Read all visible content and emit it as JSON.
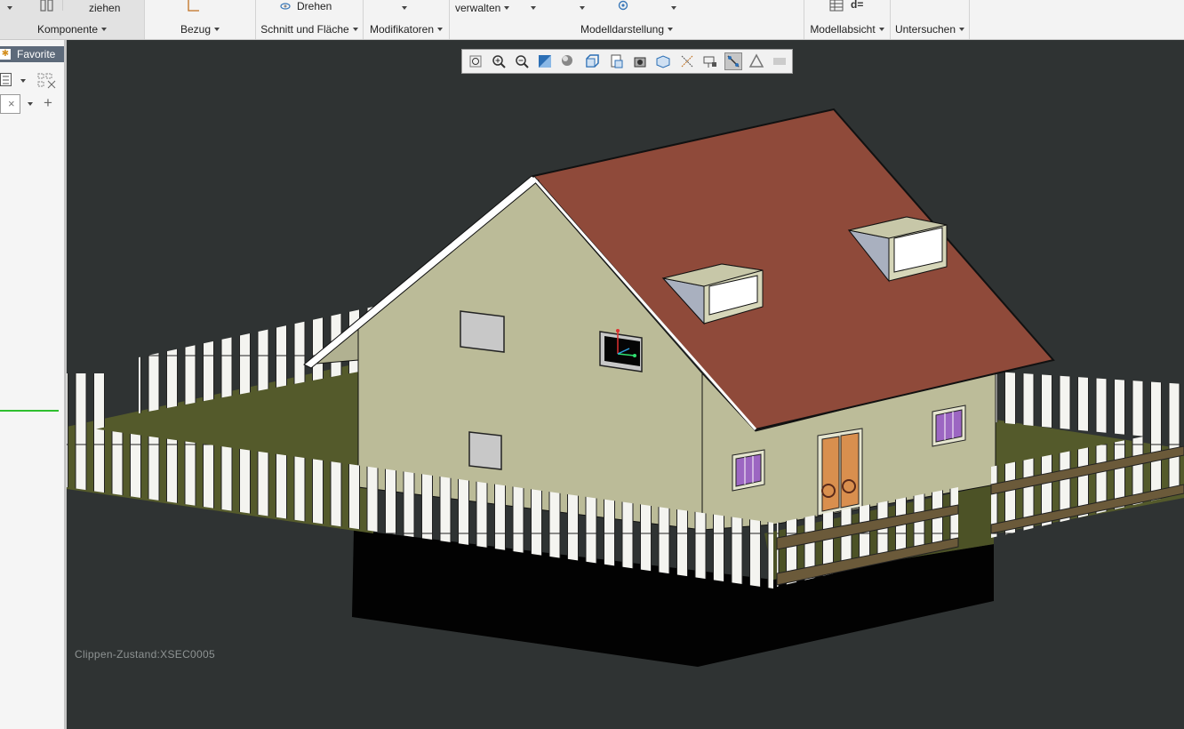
{
  "ribbon": {
    "ziehen_label": "ziehen",
    "drehen_label": "Drehen",
    "verwalten_label": "verwalten",
    "groups": {
      "komponente": "Komponente",
      "bezug": "Bezug",
      "schnitt": "Schnitt und Fläche",
      "modifikatoren": "Modifikatoren",
      "modelldarstellung": "Modelldarstellung",
      "modellabsicht": "Modellabsicht",
      "untersuchen": "Untersuchen"
    }
  },
  "left_panel": {
    "favorites_label": "Favorite",
    "accent_color": "#2fbf2f"
  },
  "view_toolbar": {
    "icons": [
      "refit-icon",
      "zoom-in-icon",
      "zoom-out-icon",
      "repaint-icon",
      "display-style-icon",
      "saved-views-icon",
      "view-manager-icon",
      "perspective-icon",
      "spin-center-icon",
      "datum-display-icon",
      "annotation-display-icon",
      "section-toggle-icon",
      "appearance-icon",
      "simulation-icon"
    ]
  },
  "viewport": {
    "clip_status": "Clippen-Zustand:XSEC0005",
    "background": "#2f3333",
    "roof_color": "#8f4a3a",
    "wall_color": "#b9b997",
    "grass_color": "#555a2c"
  }
}
